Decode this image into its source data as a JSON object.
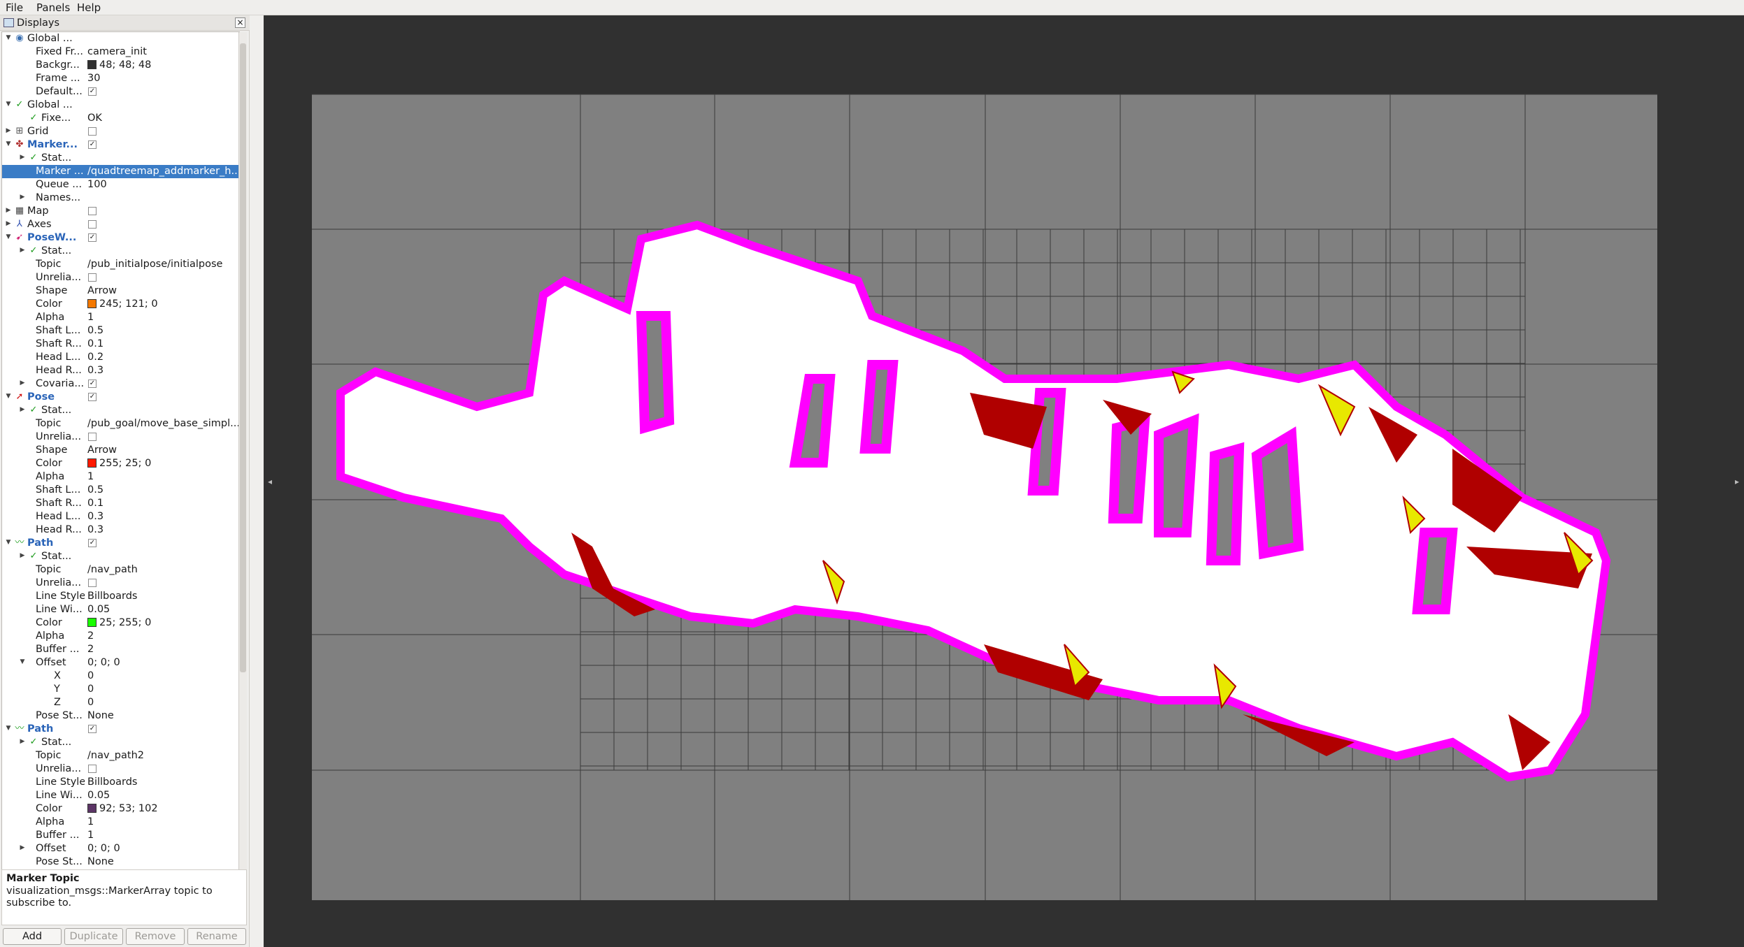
{
  "menubar": {
    "items": [
      "File",
      "Panels",
      "Help"
    ]
  },
  "displays_panel": {
    "title": "Displays",
    "close_glyph": "×",
    "rows": [
      {
        "label": "Global ...",
        "value": "",
        "level": 0,
        "arrow": "open",
        "icon": "globe-icon",
        "checkbox": null,
        "value_color": null
      },
      {
        "label": "Fixed Fr...",
        "value": "camera_init",
        "level": 1,
        "arrow": null,
        "icon": null,
        "checkbox": null,
        "value_color": null
      },
      {
        "label": "Backgr...",
        "value": "48; 48; 48",
        "level": 1,
        "arrow": null,
        "icon": null,
        "checkbox": null,
        "value_color": "#303030"
      },
      {
        "label": "Frame ...",
        "value": "30",
        "level": 1,
        "arrow": null,
        "icon": null,
        "checkbox": null,
        "value_color": null
      },
      {
        "label": "Default...",
        "value": "",
        "level": 1,
        "arrow": null,
        "icon": null,
        "checkbox": true,
        "value_color": null
      },
      {
        "label": "Global ...",
        "value": "",
        "level": 0,
        "arrow": "open",
        "icon": "check-icon",
        "checkbox": null,
        "value_color": null
      },
      {
        "label": "Fixe...",
        "value": "OK",
        "level": 1,
        "arrow": null,
        "icon": "check-icon",
        "checkbox": null,
        "value_color": null
      },
      {
        "label": "Grid",
        "value": "",
        "level": 0,
        "arrow": "closed",
        "icon": "grid-icon",
        "checkbox": false,
        "value_color": null
      },
      {
        "label": "Marker...",
        "value": "",
        "level": 0,
        "arrow": "open",
        "icon": "marker-array-icon",
        "checkbox": true,
        "value_color": null,
        "blue": true
      },
      {
        "label": "Stat...",
        "value": "",
        "level": 1,
        "arrow": "closed",
        "icon": "check-icon",
        "checkbox": null,
        "value_color": null
      },
      {
        "label": "Marker ...",
        "value": "/quadtreemap_addmarker_h...",
        "level": 1,
        "arrow": null,
        "icon": null,
        "checkbox": null,
        "value_color": null,
        "selected": true
      },
      {
        "label": "Queue ...",
        "value": "100",
        "level": 1,
        "arrow": null,
        "icon": null,
        "checkbox": null,
        "value_color": null
      },
      {
        "label": "Names...",
        "value": "",
        "level": 1,
        "arrow": "closed",
        "icon": null,
        "checkbox": null,
        "value_color": null
      },
      {
        "label": "Map",
        "value": "",
        "level": 0,
        "arrow": "closed",
        "icon": "map-icon",
        "checkbox": false,
        "value_color": null
      },
      {
        "label": "Axes",
        "value": "",
        "level": 0,
        "arrow": "closed",
        "icon": "axes-icon",
        "checkbox": false,
        "value_color": null
      },
      {
        "label": "PoseW...",
        "value": "",
        "level": 0,
        "arrow": "open",
        "icon": "pose-array-icon",
        "checkbox": true,
        "value_color": null,
        "blue": true
      },
      {
        "label": "Stat...",
        "value": "",
        "level": 1,
        "arrow": "closed",
        "icon": "check-icon",
        "checkbox": null,
        "value_color": null
      },
      {
        "label": "Topic",
        "value": "/pub_initialpose/initialpose",
        "level": 1,
        "arrow": null,
        "icon": null,
        "checkbox": null,
        "value_color": null
      },
      {
        "label": "Unrelia...",
        "value": "",
        "level": 1,
        "arrow": null,
        "icon": null,
        "checkbox": false,
        "value_color": null
      },
      {
        "label": "Shape",
        "value": "Arrow",
        "level": 1,
        "arrow": null,
        "icon": null,
        "checkbox": null,
        "value_color": null
      },
      {
        "label": "Color",
        "value": "245; 121; 0",
        "level": 1,
        "arrow": null,
        "icon": null,
        "checkbox": null,
        "value_color": "#f57900"
      },
      {
        "label": "Alpha",
        "value": "1",
        "level": 1,
        "arrow": null,
        "icon": null,
        "checkbox": null,
        "value_color": null
      },
      {
        "label": "Shaft L...",
        "value": "0.5",
        "level": 1,
        "arrow": null,
        "icon": null,
        "checkbox": null,
        "value_color": null
      },
      {
        "label": "Shaft R...",
        "value": "0.1",
        "level": 1,
        "arrow": null,
        "icon": null,
        "checkbox": null,
        "value_color": null
      },
      {
        "label": "Head L...",
        "value": "0.2",
        "level": 1,
        "arrow": null,
        "icon": null,
        "checkbox": null,
        "value_color": null
      },
      {
        "label": "Head R...",
        "value": "0.3",
        "level": 1,
        "arrow": null,
        "icon": null,
        "checkbox": null,
        "value_color": null
      },
      {
        "label": "Covaria...",
        "value": "",
        "level": 1,
        "arrow": "closed",
        "icon": null,
        "checkbox": true,
        "value_color": null
      },
      {
        "label": "Pose",
        "value": "",
        "level": 0,
        "arrow": "open",
        "icon": "pose-icon",
        "checkbox": true,
        "value_color": null,
        "blue": true
      },
      {
        "label": "Stat...",
        "value": "",
        "level": 1,
        "arrow": "closed",
        "icon": "check-icon",
        "checkbox": null,
        "value_color": null
      },
      {
        "label": "Topic",
        "value": "/pub_goal/move_base_simpl...",
        "level": 1,
        "arrow": null,
        "icon": null,
        "checkbox": null,
        "value_color": null
      },
      {
        "label": "Unrelia...",
        "value": "",
        "level": 1,
        "arrow": null,
        "icon": null,
        "checkbox": false,
        "value_color": null
      },
      {
        "label": "Shape",
        "value": "Arrow",
        "level": 1,
        "arrow": null,
        "icon": null,
        "checkbox": null,
        "value_color": null
      },
      {
        "label": "Color",
        "value": "255; 25; 0",
        "level": 1,
        "arrow": null,
        "icon": null,
        "checkbox": null,
        "value_color": "#ff1900"
      },
      {
        "label": "Alpha",
        "value": "1",
        "level": 1,
        "arrow": null,
        "icon": null,
        "checkbox": null,
        "value_color": null
      },
      {
        "label": "Shaft L...",
        "value": "0.5",
        "level": 1,
        "arrow": null,
        "icon": null,
        "checkbox": null,
        "value_color": null
      },
      {
        "label": "Shaft R...",
        "value": "0.1",
        "level": 1,
        "arrow": null,
        "icon": null,
        "checkbox": null,
        "value_color": null
      },
      {
        "label": "Head L...",
        "value": "0.3",
        "level": 1,
        "arrow": null,
        "icon": null,
        "checkbox": null,
        "value_color": null
      },
      {
        "label": "Head R...",
        "value": "0.3",
        "level": 1,
        "arrow": null,
        "icon": null,
        "checkbox": null,
        "value_color": null
      },
      {
        "label": "Path",
        "value": "",
        "level": 0,
        "arrow": "open",
        "icon": "path-icon",
        "checkbox": true,
        "value_color": null,
        "blue": true
      },
      {
        "label": "Stat...",
        "value": "",
        "level": 1,
        "arrow": "closed",
        "icon": "check-icon",
        "checkbox": null,
        "value_color": null
      },
      {
        "label": "Topic",
        "value": "/nav_path",
        "level": 1,
        "arrow": null,
        "icon": null,
        "checkbox": null,
        "value_color": null
      },
      {
        "label": "Unrelia...",
        "value": "",
        "level": 1,
        "arrow": null,
        "icon": null,
        "checkbox": false,
        "value_color": null
      },
      {
        "label": "Line Style",
        "value": "Billboards",
        "level": 1,
        "arrow": null,
        "icon": null,
        "checkbox": null,
        "value_color": null
      },
      {
        "label": "Line Wi...",
        "value": "0.05",
        "level": 1,
        "arrow": null,
        "icon": null,
        "checkbox": null,
        "value_color": null
      },
      {
        "label": "Color",
        "value": "25; 255; 0",
        "level": 1,
        "arrow": null,
        "icon": null,
        "checkbox": null,
        "value_color": "#19ff00"
      },
      {
        "label": "Alpha",
        "value": "2",
        "level": 1,
        "arrow": null,
        "icon": null,
        "checkbox": null,
        "value_color": null
      },
      {
        "label": "Buffer ...",
        "value": "2",
        "level": 1,
        "arrow": null,
        "icon": null,
        "checkbox": null,
        "value_color": null
      },
      {
        "label": "Offset",
        "value": "0; 0; 0",
        "level": 1,
        "arrow": "open",
        "icon": null,
        "checkbox": null,
        "value_color": null
      },
      {
        "label": "X",
        "value": "0",
        "level": 2,
        "arrow": null,
        "icon": null,
        "checkbox": null,
        "value_color": null
      },
      {
        "label": "Y",
        "value": "0",
        "level": 2,
        "arrow": null,
        "icon": null,
        "checkbox": null,
        "value_color": null
      },
      {
        "label": "Z",
        "value": "0",
        "level": 2,
        "arrow": null,
        "icon": null,
        "checkbox": null,
        "value_color": null
      },
      {
        "label": "Pose St...",
        "value": "None",
        "level": 1,
        "arrow": null,
        "icon": null,
        "checkbox": null,
        "value_color": null
      },
      {
        "label": "Path",
        "value": "",
        "level": 0,
        "arrow": "open",
        "icon": "path-icon",
        "checkbox": true,
        "value_color": null,
        "blue": true
      },
      {
        "label": "Stat...",
        "value": "",
        "level": 1,
        "arrow": "closed",
        "icon": "check-icon",
        "checkbox": null,
        "value_color": null
      },
      {
        "label": "Topic",
        "value": "/nav_path2",
        "level": 1,
        "arrow": null,
        "icon": null,
        "checkbox": null,
        "value_color": null
      },
      {
        "label": "Unrelia...",
        "value": "",
        "level": 1,
        "arrow": null,
        "icon": null,
        "checkbox": false,
        "value_color": null
      },
      {
        "label": "Line Style",
        "value": "Billboards",
        "level": 1,
        "arrow": null,
        "icon": null,
        "checkbox": null,
        "value_color": null
      },
      {
        "label": "Line Wi...",
        "value": "0.05",
        "level": 1,
        "arrow": null,
        "icon": null,
        "checkbox": null,
        "value_color": null
      },
      {
        "label": "Color",
        "value": "92; 53; 102",
        "level": 1,
        "arrow": null,
        "icon": null,
        "checkbox": null,
        "value_color": "#5c3566"
      },
      {
        "label": "Alpha",
        "value": "1",
        "level": 1,
        "arrow": null,
        "icon": null,
        "checkbox": null,
        "value_color": null
      },
      {
        "label": "Buffer ...",
        "value": "1",
        "level": 1,
        "arrow": null,
        "icon": null,
        "checkbox": null,
        "value_color": null
      },
      {
        "label": "Offset",
        "value": "0; 0; 0",
        "level": 1,
        "arrow": "closed",
        "icon": null,
        "checkbox": null,
        "value_color": null
      },
      {
        "label": "Pose St...",
        "value": "None",
        "level": 1,
        "arrow": null,
        "icon": null,
        "checkbox": null,
        "value_color": null
      }
    ]
  },
  "description": {
    "title": "Marker Topic",
    "text": "visualization_msgs::MarkerArray topic to subscribe to."
  },
  "buttons": {
    "add": "Add",
    "duplicate": "Duplicate",
    "remove": "Remove",
    "rename": "Rename"
  },
  "viewport": {
    "background_color": "#303030",
    "map_free_color": "#ffffff",
    "map_unknown_color": "#808080",
    "inflation_color": "#ff00ff",
    "obstacle_color": "#b00000",
    "cost_color": "#e8e800",
    "left_arrow": "◂",
    "right_arrow": "▸"
  }
}
